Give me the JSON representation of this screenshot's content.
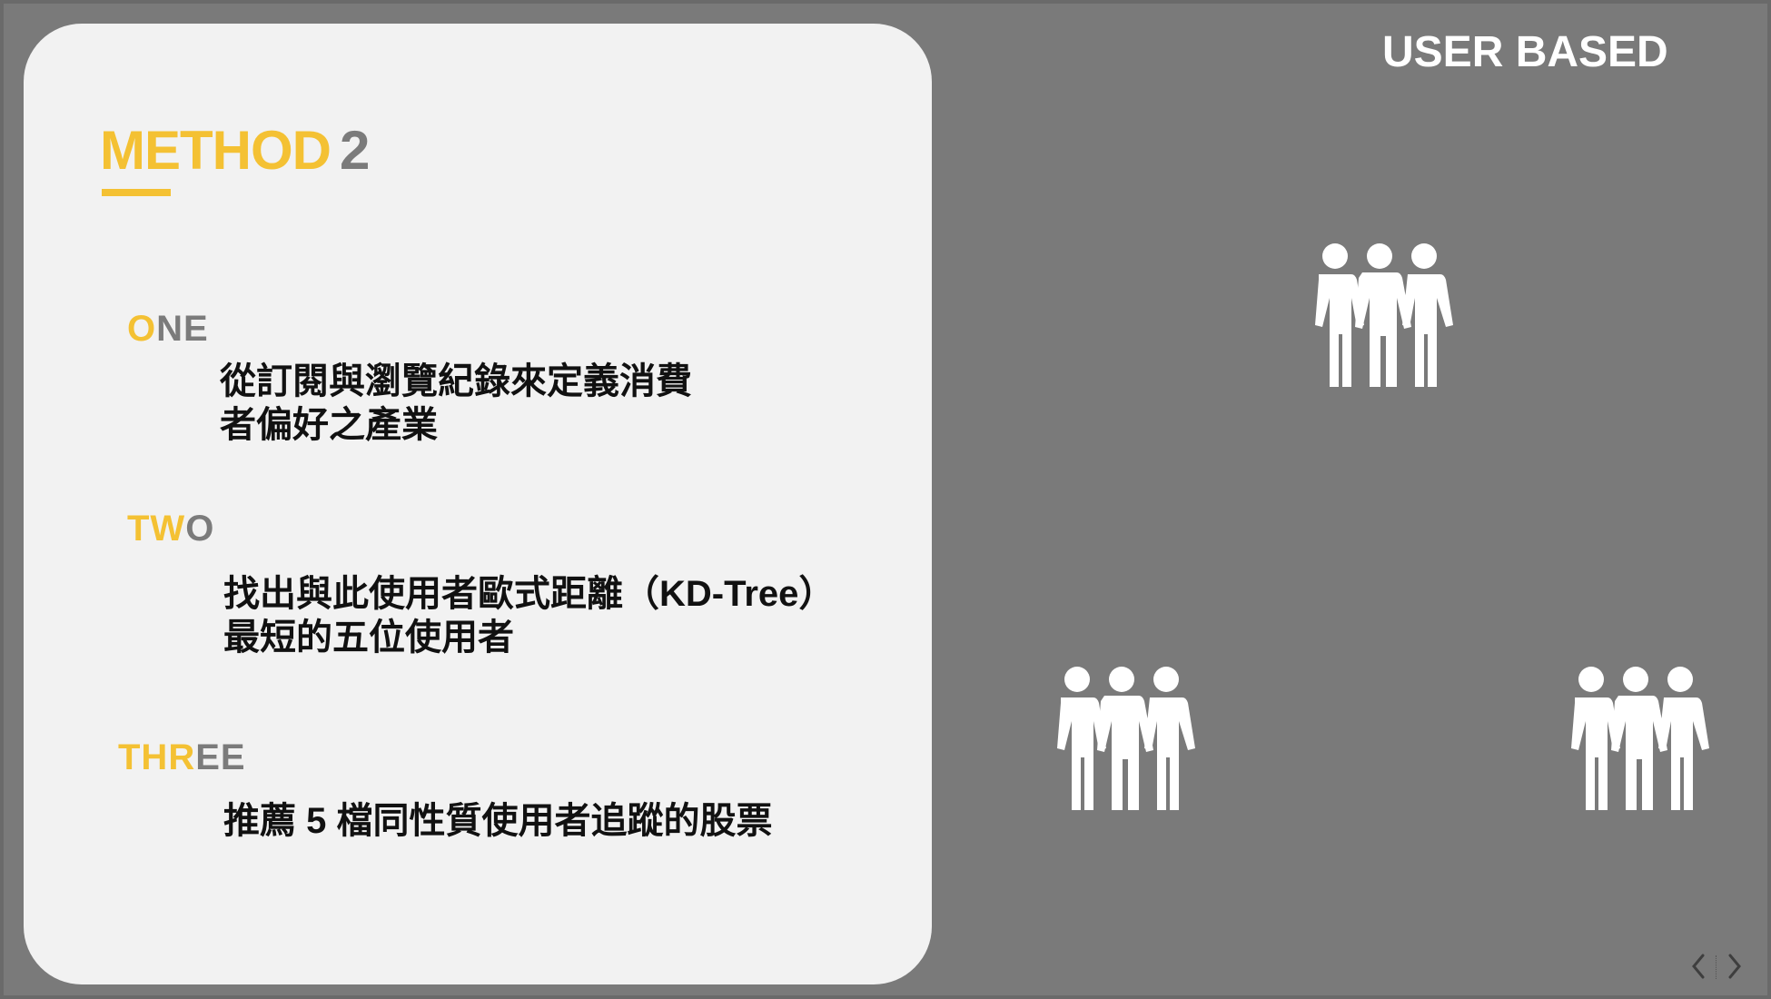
{
  "slide": {
    "corner_title": "USER BASED",
    "method": {
      "word": "METHOD",
      "number": "2"
    },
    "steps": [
      {
        "label_highlight": "O",
        "label_rest": "NE",
        "lines": [
          "從訂閱與瀏覽紀錄來定義消費",
          "者偏好之產業"
        ]
      },
      {
        "label_highlight": "TW",
        "label_rest": "O",
        "lines": [
          "找出與此使用者歐式距離（KD-Tree）",
          "最短的五位使用者"
        ]
      },
      {
        "label_highlight": "THR",
        "label_rest": "EE",
        "lines": [
          "推薦 5 檔同性質使用者追蹤的股票"
        ]
      }
    ],
    "icons": {
      "group": "people-group-icon",
      "prev": "chevron-left-icon",
      "next": "chevron-right-icon"
    }
  },
  "colors": {
    "background": "#7a7a7a",
    "card": "#f2f2f2",
    "accent": "#f4c133",
    "muted_text": "#7b7b7b",
    "body_text": "#111111",
    "icon": "#ffffff"
  }
}
